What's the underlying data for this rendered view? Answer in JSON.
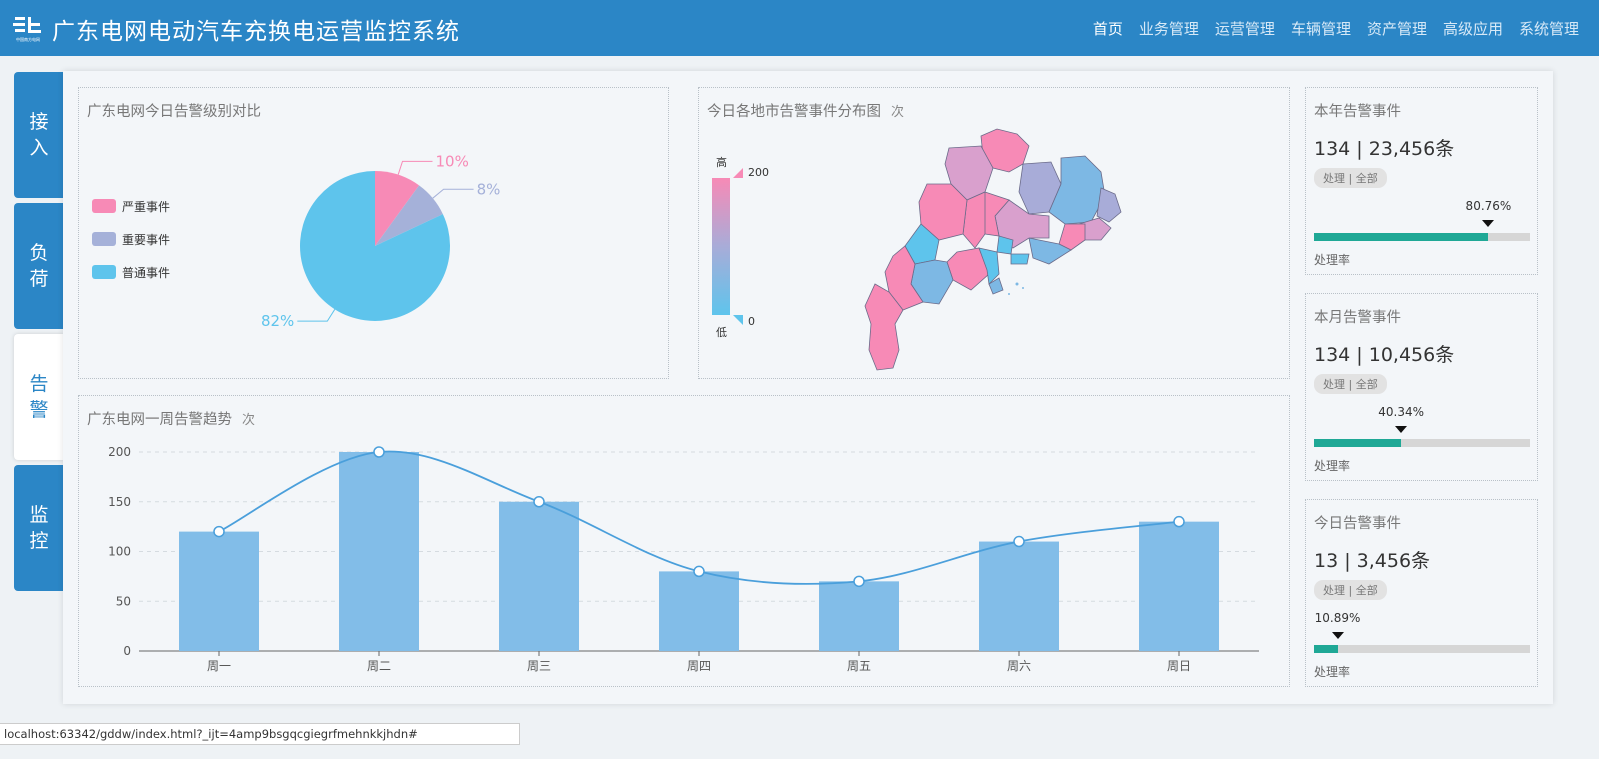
{
  "app": {
    "title": "广东电网电动汽车充换电运营监控系统",
    "logo_text": "中国南方电网"
  },
  "topnav": [
    {
      "label": "首页",
      "active": true
    },
    {
      "label": "业务管理"
    },
    {
      "label": "运营管理"
    },
    {
      "label": "车辆管理"
    },
    {
      "label": "资产管理"
    },
    {
      "label": "高级应用"
    },
    {
      "label": "系统管理"
    }
  ],
  "sidetabs": [
    {
      "label": "接入"
    },
    {
      "label": "负荷"
    },
    {
      "label": "告警",
      "active": true
    },
    {
      "label": "监控"
    }
  ],
  "pie_panel": {
    "title": "广东电网今日告警级别对比"
  },
  "map_panel": {
    "title": "今日各地市告警事件分布图",
    "unit": "次",
    "legend": {
      "high_label": "高",
      "low_label": "低",
      "max": "200",
      "min": "0"
    },
    "colors": {
      "high": "#f78ab6",
      "mid": "#a8acd8",
      "low": "#5ec4ec"
    }
  },
  "bar_panel": {
    "title": "广东电网一周告警趋势",
    "unit": "次"
  },
  "stats": [
    {
      "title": "本年告警事件",
      "value": "134 | 23,456条",
      "badge": "处理 | 全部",
      "pct_label": "80.76%",
      "rate": 0.8076,
      "rate_label": "处理率"
    },
    {
      "title": "本月告警事件",
      "value": "134 | 10,456条",
      "badge": "处理 | 全部",
      "pct_label": "40.34%",
      "rate": 0.4034,
      "rate_label": "处理率"
    },
    {
      "title": "今日告警事件",
      "value": "13 | 3,456条",
      "badge": "处理 | 全部",
      "pct_label": "10.89%",
      "rate": 0.1089,
      "rate_label": "处理率"
    }
  ],
  "statusbar": {
    "url": "localhost:63342/gddw/index.html?_ijt=4amp9bsgqcgiegrfmehnkkjhdn#"
  },
  "colors": {
    "header": "#2b86c6",
    "progress": "#1fa896",
    "bar": "#82bde8",
    "line": "#4a9fdb"
  },
  "chart_data": [
    {
      "type": "pie",
      "title": "广东电网今日告警级别对比",
      "series": [
        {
          "name": "严重事件",
          "value": 10,
          "label": "10%",
          "color": "#f78ab6"
        },
        {
          "name": "重要事件",
          "value": 8,
          "label": "8%",
          "color": "#a5b1d9"
        },
        {
          "name": "普通事件",
          "value": 82,
          "label": "82%",
          "color": "#5ec4ec"
        }
      ],
      "legend": "left"
    },
    {
      "type": "bar",
      "title": "广东电网一周告警趋势",
      "categories": [
        "周一",
        "周二",
        "周三",
        "周四",
        "周五",
        "周六",
        "周日"
      ],
      "series": [
        {
          "type": "bar",
          "values": [
            120,
            200,
            150,
            80,
            70,
            110,
            130
          ]
        },
        {
          "type": "line",
          "smooth": true,
          "values": [
            120,
            200,
            150,
            80,
            70,
            110,
            130
          ]
        }
      ],
      "yticks": [
        "0",
        "50",
        "100",
        "150",
        "200"
      ],
      "ylim": [
        0,
        200
      ],
      "grid": "horizontal dashed"
    }
  ]
}
